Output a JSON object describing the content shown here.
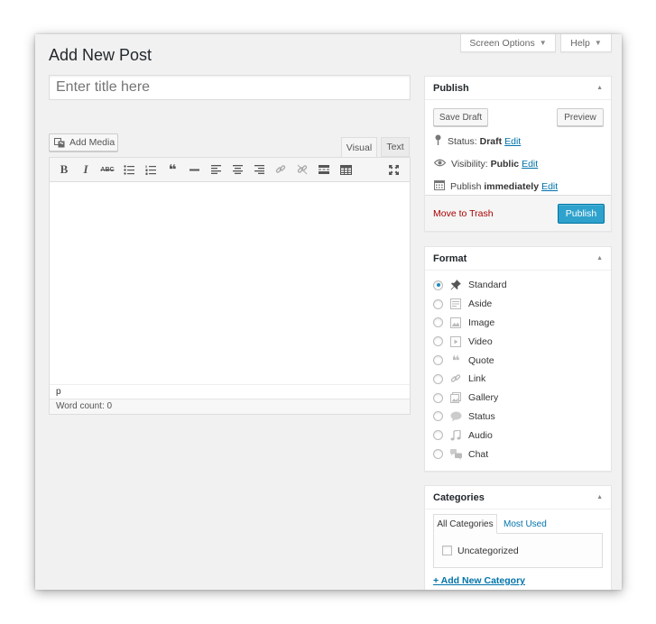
{
  "header": {
    "page_title": "Add New Post",
    "screen_options_label": "Screen Options",
    "help_label": "Help"
  },
  "title_field": {
    "value": "",
    "placeholder": "Enter title here"
  },
  "editor": {
    "add_media_label": "Add Media",
    "tab_visual": "Visual",
    "tab_text": "Text",
    "toolbar_icons": [
      "bold-icon",
      "italic-icon",
      "strikethrough-icon",
      "bulleted-list-icon",
      "numbered-list-icon",
      "blockquote-icon",
      "horizontal-line-icon",
      "align-left-icon",
      "align-center-icon",
      "align-right-icon",
      "insert-link-icon",
      "remove-link-icon",
      "read-more-icon",
      "toolbar-toggle-icon",
      "fullscreen-icon"
    ],
    "path": "p",
    "word_count": "Word count: 0"
  },
  "publish": {
    "title": "Publish",
    "save_draft": "Save Draft",
    "preview": "Preview",
    "status_label": "Status:",
    "status_value": "Draft",
    "visibility_label": "Visibility:",
    "visibility_value": "Public",
    "schedule_label": "Publish",
    "schedule_value": "immediately",
    "edit": "Edit",
    "move_to_trash": "Move to Trash",
    "publish_button": "Publish"
  },
  "format": {
    "title": "Format",
    "selected": "Standard",
    "options": [
      {
        "label": "Standard",
        "icon": "pushpin-icon"
      },
      {
        "label": "Aside",
        "icon": "aside-icon"
      },
      {
        "label": "Image",
        "icon": "image-icon"
      },
      {
        "label": "Video",
        "icon": "video-icon"
      },
      {
        "label": "Quote",
        "icon": "quote-icon"
      },
      {
        "label": "Link",
        "icon": "link-icon"
      },
      {
        "label": "Gallery",
        "icon": "gallery-icon"
      },
      {
        "label": "Status",
        "icon": "status-bubble-icon"
      },
      {
        "label": "Audio",
        "icon": "audio-icon"
      },
      {
        "label": "Chat",
        "icon": "chat-icon"
      }
    ]
  },
  "categories": {
    "title": "Categories",
    "tab_all": "All Categories",
    "tab_most_used": "Most Used",
    "items": [
      {
        "label": "Uncategorized",
        "checked": false
      }
    ],
    "add_new": "+ Add New Category"
  },
  "colors": {
    "background": "#f1f1f1",
    "link": "#0073aa",
    "publish_button": "#2ea2cc",
    "trash_link": "#aa0000"
  }
}
